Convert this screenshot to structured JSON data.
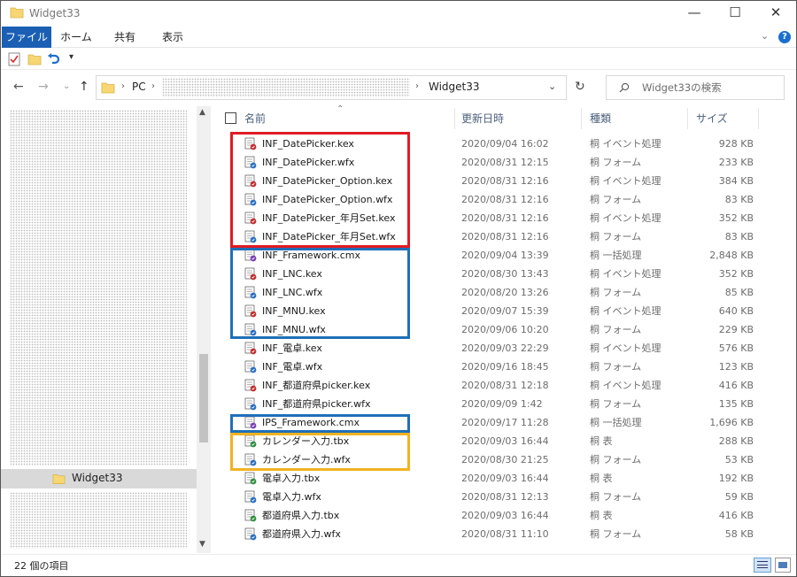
{
  "window": {
    "title": "Widget33"
  },
  "ribbon": {
    "tabs": [
      "ファイル",
      "ホーム",
      "共有",
      "表示"
    ]
  },
  "address": {
    "root": "PC",
    "current": "Widget33"
  },
  "search": {
    "placeholder": "Widget33の検索"
  },
  "navpane": {
    "selected": "Widget33"
  },
  "columns": {
    "name": "名前",
    "date": "更新日時",
    "type": "種類",
    "size": "サイズ"
  },
  "files": [
    {
      "name": "INF_DatePicker.kex",
      "date": "2020/09/04 16:02",
      "type": "桐 イベント処理",
      "size": "928 KB",
      "icon": "kex-file-icon"
    },
    {
      "name": "INF_DatePicker.wfx",
      "date": "2020/08/31 12:15",
      "type": "桐 フォーム",
      "size": "233 KB",
      "icon": "wfx-file-icon"
    },
    {
      "name": "INF_DatePicker_Option.kex",
      "date": "2020/08/31 12:16",
      "type": "桐 イベント処理",
      "size": "384 KB",
      "icon": "kex-file-icon"
    },
    {
      "name": "INF_DatePicker_Option.wfx",
      "date": "2020/08/31 12:16",
      "type": "桐 フォーム",
      "size": "83 KB",
      "icon": "wfx-file-icon"
    },
    {
      "name": "INF_DatePicker_年月Set.kex",
      "date": "2020/08/31 12:16",
      "type": "桐 イベント処理",
      "size": "352 KB",
      "icon": "kex-file-icon"
    },
    {
      "name": "INF_DatePicker_年月Set.wfx",
      "date": "2020/08/31 12:16",
      "type": "桐 フォーム",
      "size": "83 KB",
      "icon": "wfx-file-icon"
    },
    {
      "name": "INF_Framework.cmx",
      "date": "2020/09/04 13:39",
      "type": "桐 一括処理",
      "size": "2,848 KB",
      "icon": "cmx-file-icon"
    },
    {
      "name": "INF_LNC.kex",
      "date": "2020/08/30 13:43",
      "type": "桐 イベント処理",
      "size": "352 KB",
      "icon": "kex-file-icon"
    },
    {
      "name": "INF_LNC.wfx",
      "date": "2020/08/20 13:26",
      "type": "桐 フォーム",
      "size": "85 KB",
      "icon": "wfx-file-icon"
    },
    {
      "name": "INF_MNU.kex",
      "date": "2020/09/07 15:39",
      "type": "桐 イベント処理",
      "size": "640 KB",
      "icon": "kex-file-icon"
    },
    {
      "name": "INF_MNU.wfx",
      "date": "2020/09/06 10:20",
      "type": "桐 フォーム",
      "size": "229 KB",
      "icon": "wfx-file-icon"
    },
    {
      "name": "INF_電卓.kex",
      "date": "2020/09/03 22:29",
      "type": "桐 イベント処理",
      "size": "576 KB",
      "icon": "kex-file-icon"
    },
    {
      "name": "INF_電卓.wfx",
      "date": "2020/09/16 18:45",
      "type": "桐 フォーム",
      "size": "123 KB",
      "icon": "wfx-file-icon"
    },
    {
      "name": "INF_都道府県picker.kex",
      "date": "2020/08/31 12:18",
      "type": "桐 イベント処理",
      "size": "416 KB",
      "icon": "kex-file-icon"
    },
    {
      "name": "INF_都道府県picker.wfx",
      "date": "2020/09/09 1:42",
      "type": "桐 フォーム",
      "size": "135 KB",
      "icon": "wfx-file-icon"
    },
    {
      "name": "IPS_Framework.cmx",
      "date": "2020/09/17 11:28",
      "type": "桐 一括処理",
      "size": "1,696 KB",
      "icon": "cmx-file-icon"
    },
    {
      "name": "カレンダー入力.tbx",
      "date": "2020/09/03 16:44",
      "type": "桐 表",
      "size": "288 KB",
      "icon": "tbx-file-icon"
    },
    {
      "name": "カレンダー入力.wfx",
      "date": "2020/08/30 21:25",
      "type": "桐 フォーム",
      "size": "53 KB",
      "icon": "wfx-file-icon"
    },
    {
      "name": "電卓入力.tbx",
      "date": "2020/09/03 16:44",
      "type": "桐 表",
      "size": "192 KB",
      "icon": "tbx-file-icon"
    },
    {
      "name": "電卓入力.wfx",
      "date": "2020/08/31 12:13",
      "type": "桐 フォーム",
      "size": "59 KB",
      "icon": "wfx-file-icon"
    },
    {
      "name": "都道府県入力.tbx",
      "date": "2020/09/03 16:44",
      "type": "桐 表",
      "size": "416 KB",
      "icon": "tbx-file-icon"
    },
    {
      "name": "都道府県入力.wfx",
      "date": "2020/08/31 11:10",
      "type": "桐 フォーム",
      "size": "58 KB",
      "icon": "wfx-file-icon"
    }
  ],
  "highlight_colors": {
    "red": "#e01b24",
    "blue": "#1f6fb8",
    "yellow": "#f0b323"
  },
  "status": {
    "count": "22 個の項目"
  }
}
